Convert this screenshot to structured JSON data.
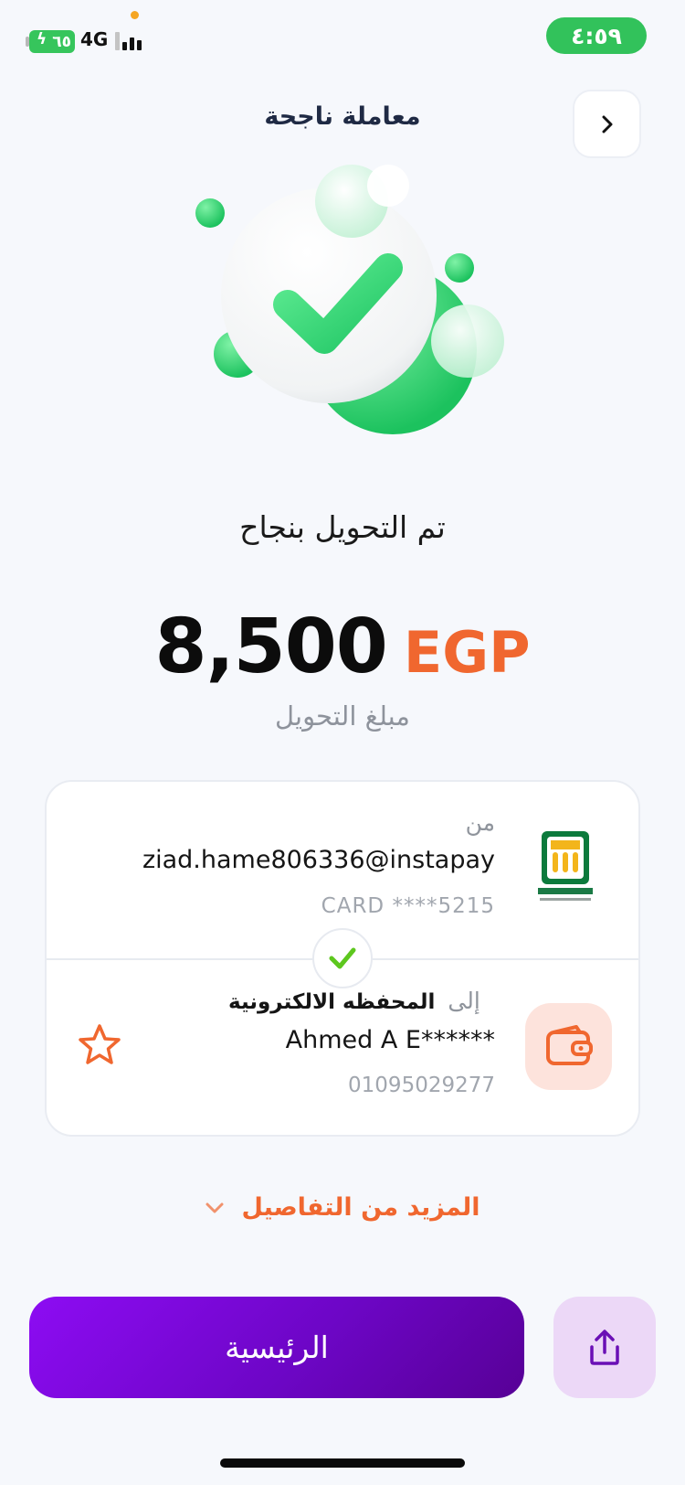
{
  "status_bar": {
    "time": "٤:٥٩",
    "battery_level": "٦٥",
    "network": "4G",
    "colors": {
      "time_pill": "#32c25b",
      "battery": "#36c55c"
    }
  },
  "header": {
    "title": "معاملة ناجحة",
    "back_icon": "chevron-right-icon"
  },
  "hero": {
    "icon": "success-check-illustration"
  },
  "result": {
    "message": "تم التحويل بنجاح",
    "amount": "8,500",
    "currency": "EGP",
    "amount_label": "مبلغ التحويل"
  },
  "transfer": {
    "from": {
      "label": "من",
      "account": "ziad.hame806336@instapay",
      "card": "CARD  ****5215",
      "bank_logo": "national-bank-of-egypt-logo"
    },
    "to": {
      "label": "إلى",
      "type": "المحفظه الالكترونية",
      "name": "Ahmed A E******",
      "phone": "01095029277",
      "icon": "wallet-icon",
      "favorite_icon": "star-icon"
    }
  },
  "more_details": {
    "label": "المزيد من التفاصيل",
    "icon": "chevron-down-icon"
  },
  "actions": {
    "home_label": "الرئيسية",
    "share_icon": "share-icon"
  },
  "colors": {
    "accent_orange": "#f0672f",
    "primary_purple": "#7b08d8",
    "success_green": "#3ccf72"
  }
}
